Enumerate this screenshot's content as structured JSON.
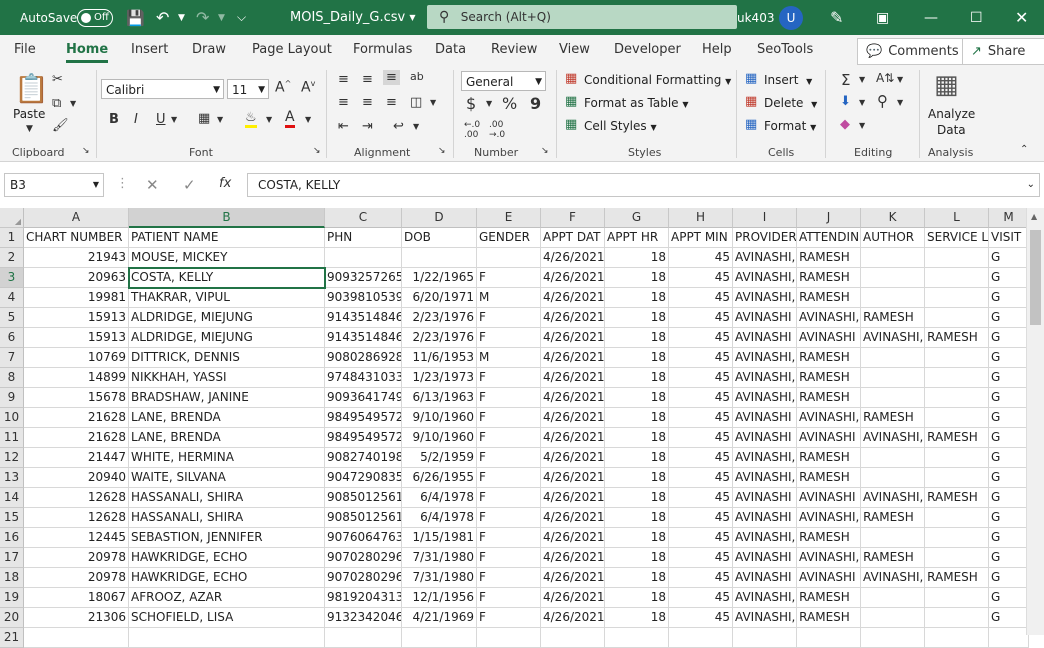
{
  "titlebar": {
    "autosave_label": "AutoSave",
    "autosave_state": "Off",
    "filename": "MOIS_Daily_G.csv",
    "search_placeholder": "Search (Alt+Q)",
    "user_name": "uk403",
    "avatar_initial": "U"
  },
  "menu": {
    "tabs": [
      "File",
      "Home",
      "Insert",
      "Draw",
      "Page Layout",
      "Formulas",
      "Data",
      "Review",
      "View",
      "Developer",
      "Help",
      "SeoTools"
    ],
    "active_tab": "Home",
    "comments_label": "Comments",
    "share_label": "Share"
  },
  "ribbon": {
    "clipboard": {
      "paste_label": "Paste",
      "group_label": "Clipboard"
    },
    "font": {
      "font_name": "Calibri",
      "font_size": "11",
      "group_label": "Font",
      "bold": "B",
      "italic": "I",
      "underline": "U"
    },
    "alignment": {
      "group_label": "Alignment"
    },
    "number": {
      "format": "General",
      "group_label": "Number",
      "currency": "$",
      "percent": "%",
      "comma": "9"
    },
    "styles": {
      "conditional_formatting": "Conditional Formatting",
      "format_as_table": "Format as Table",
      "cell_styles": "Cell Styles",
      "group_label": "Styles"
    },
    "cells": {
      "insert": "Insert",
      "delete": "Delete",
      "format": "Format",
      "group_label": "Cells"
    },
    "editing": {
      "group_label": "Editing"
    },
    "analysis": {
      "analyze_data": "Analyze",
      "analyze_data_2": "Data",
      "group_label": "Analysis"
    }
  },
  "formula_bar": {
    "name_box": "B3",
    "fx": "fx",
    "content": "COSTA, KELLY"
  },
  "sheet": {
    "columns": [
      "A",
      "B",
      "C",
      "D",
      "E",
      "F",
      "G",
      "H",
      "I",
      "J",
      "K",
      "L",
      "M"
    ],
    "active_column": "B",
    "active_row": "3",
    "row_numbers": [
      "1",
      "2",
      "3",
      "4",
      "5",
      "6",
      "7",
      "8",
      "9",
      "10",
      "11",
      "12",
      "13",
      "14",
      "15",
      "16",
      "17",
      "18",
      "19",
      "20",
      "21"
    ],
    "header_row": [
      "CHART NUMBER",
      "PATIENT NAME",
      "PHN",
      "DOB",
      "GENDER",
      "APPT DAT",
      "APPT HR",
      "APPT MIN",
      "PROVIDER",
      "ATTENDIN",
      "AUTHOR",
      "SERVICE L",
      "VISIT"
    ],
    "rows": [
      [
        "21943",
        "MOUSE, MICKEY",
        "",
        "",
        "",
        "4/26/2021",
        "18",
        "45",
        "AVINASHI, RAMESH",
        "",
        "",
        "",
        "G"
      ],
      [
        "20963",
        "COSTA, KELLY",
        "9093257265",
        "1/22/1965",
        "F",
        "4/26/2021",
        "18",
        "45",
        "AVINASHI, RAMESH",
        "",
        "",
        "",
        "G"
      ],
      [
        "19981",
        "THAKRAR, VIPUL",
        "9039810539",
        "6/20/1971",
        "M",
        "4/26/2021",
        "18",
        "45",
        "AVINASHI, RAMESH",
        "",
        "",
        "",
        "G"
      ],
      [
        "15913",
        "ALDRIDGE, MIEJUNG",
        "9143514846",
        "2/23/1976",
        "F",
        "4/26/2021",
        "18",
        "45",
        "AVINASHI",
        "AVINASHI, RAMESH",
        "",
        "",
        "G"
      ],
      [
        "15913",
        "ALDRIDGE, MIEJUNG",
        "9143514846",
        "2/23/1976",
        "F",
        "4/26/2021",
        "18",
        "45",
        "AVINASHI",
        "AVINASHI",
        "AVINASHI, RAMESH",
        "",
        "G"
      ],
      [
        "10769",
        "DITTRICK, DENNIS",
        "9080286928",
        "11/6/1953",
        "M",
        "4/26/2021",
        "18",
        "45",
        "AVINASHI, RAMESH",
        "",
        "",
        "",
        "G"
      ],
      [
        "14899",
        "NIKKHAH, YASSI",
        "9748431033",
        "1/23/1973",
        "F",
        "4/26/2021",
        "18",
        "45",
        "AVINASHI, RAMESH",
        "",
        "",
        "",
        "G"
      ],
      [
        "15678",
        "BRADSHAW, JANINE",
        "9093641749",
        "6/13/1963",
        "F",
        "4/26/2021",
        "18",
        "45",
        "AVINASHI, RAMESH",
        "",
        "",
        "",
        "G"
      ],
      [
        "21628",
        "LANE, BRENDA",
        "9849549572",
        "9/10/1960",
        "F",
        "4/26/2021",
        "18",
        "45",
        "AVINASHI",
        "AVINASHI, RAMESH",
        "",
        "",
        "G"
      ],
      [
        "21628",
        "LANE, BRENDA",
        "9849549572",
        "9/10/1960",
        "F",
        "4/26/2021",
        "18",
        "45",
        "AVINASHI",
        "AVINASHI",
        "AVINASHI, RAMESH",
        "",
        "G"
      ],
      [
        "21447",
        "WHITE, HERMINA",
        "9082740198",
        "5/2/1959",
        "F",
        "4/26/2021",
        "18",
        "45",
        "AVINASHI, RAMESH",
        "",
        "",
        "",
        "G"
      ],
      [
        "20940",
        "WAITE, SILVANA",
        "9047290835",
        "6/26/1955",
        "F",
        "4/26/2021",
        "18",
        "45",
        "AVINASHI, RAMESH",
        "",
        "",
        "",
        "G"
      ],
      [
        "12628",
        "HASSANALI, SHIRA",
        "9085012561",
        "6/4/1978",
        "F",
        "4/26/2021",
        "18",
        "45",
        "AVINASHI",
        "AVINASHI",
        "AVINASHI, RAMESH",
        "",
        "G"
      ],
      [
        "12628",
        "HASSANALI, SHIRA",
        "9085012561",
        "6/4/1978",
        "F",
        "4/26/2021",
        "18",
        "45",
        "AVINASHI",
        "AVINASHI, RAMESH",
        "",
        "",
        "G"
      ],
      [
        "12445",
        "SEBASTION, JENNIFER",
        "9076064763",
        "1/15/1981",
        "F",
        "4/26/2021",
        "18",
        "45",
        "AVINASHI, RAMESH",
        "",
        "",
        "",
        "G"
      ],
      [
        "20978",
        "HAWKRIDGE, ECHO",
        "9070280296",
        "7/31/1980",
        "F",
        "4/26/2021",
        "18",
        "45",
        "AVINASHI",
        "AVINASHI, RAMESH",
        "",
        "",
        "G"
      ],
      [
        "20978",
        "HAWKRIDGE, ECHO",
        "9070280296",
        "7/31/1980",
        "F",
        "4/26/2021",
        "18",
        "45",
        "AVINASHI",
        "AVINASHI",
        "AVINASHI, RAMESH",
        "",
        "G"
      ],
      [
        "18067",
        "AFROOZ, AZAR",
        "9819204313",
        "12/1/1956",
        "F",
        "4/26/2021",
        "18",
        "45",
        "AVINASHI, RAMESH",
        "",
        "",
        "",
        "G"
      ],
      [
        "21306",
        "SCHOFIELD, LISA",
        "9132342046",
        "4/21/1969",
        "F",
        "4/26/2021",
        "18",
        "45",
        "AVINASHI, RAMESH",
        "",
        "",
        "",
        "G"
      ]
    ]
  },
  "colors": {
    "accent": "#217346",
    "titlebar_bg": "#217346",
    "avatar": "#2565c2"
  }
}
